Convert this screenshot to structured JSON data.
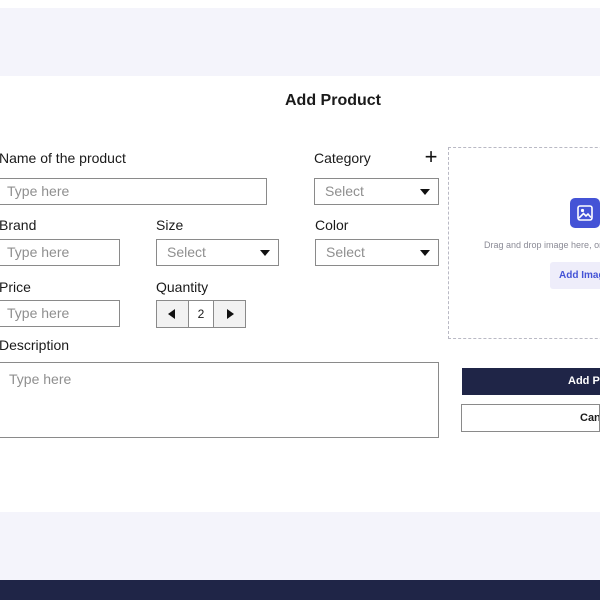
{
  "page": {
    "title": "Add Product"
  },
  "form": {
    "name": {
      "label": "Name of the product",
      "placeholder": "Type here"
    },
    "category": {
      "label": "Category",
      "value": "Select",
      "add_icon": "plus-icon"
    },
    "brand": {
      "label": "Brand",
      "placeholder": "Type here"
    },
    "size": {
      "label": "Size",
      "value": "Select"
    },
    "color": {
      "label": "Color",
      "value": "Select"
    },
    "price": {
      "label": "Price",
      "placeholder": "Type here"
    },
    "quantity": {
      "label": "Quantity",
      "value": "2"
    },
    "description": {
      "label": "Description",
      "placeholder": "Type here"
    }
  },
  "upload": {
    "icon": "image-upload-icon",
    "hint": "Drag and drop image here, or",
    "button_label": "Add Image"
  },
  "actions": {
    "primary_label": "Add Product",
    "secondary_label": "Cancel"
  },
  "colors": {
    "accent": "#4453d6",
    "navy": "#1f2547",
    "band": "#f4f4fb"
  }
}
